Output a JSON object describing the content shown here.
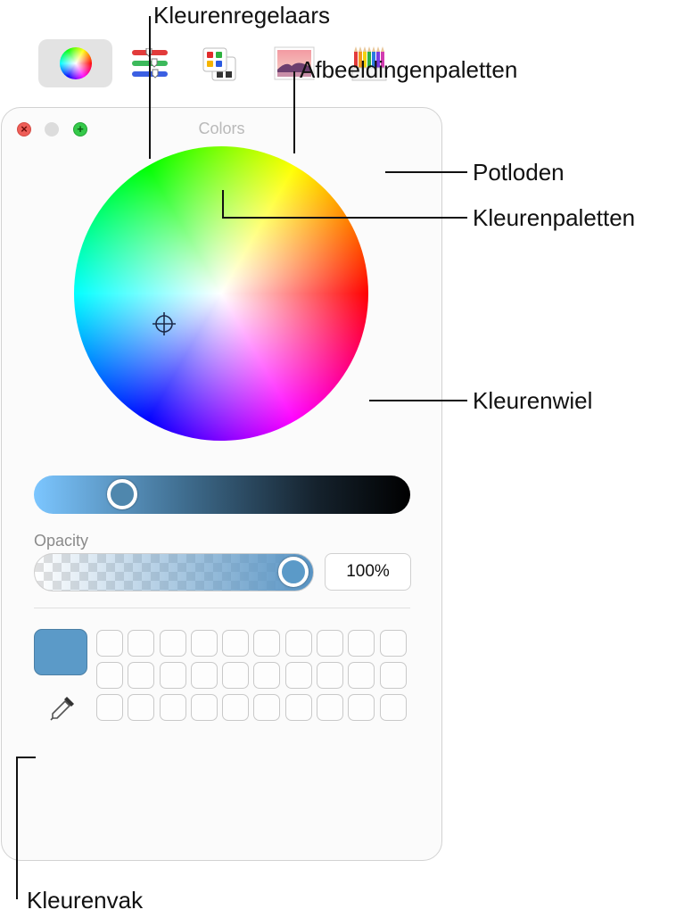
{
  "window": {
    "title": "Colors",
    "traffic": {
      "close": "×",
      "zoom": "+"
    }
  },
  "toolbar": {
    "items": [
      {
        "icon": "color-wheel-icon",
        "active": true
      },
      {
        "icon": "color-sliders-icon",
        "active": false
      },
      {
        "icon": "color-palettes-icon",
        "active": false
      },
      {
        "icon": "image-palettes-icon",
        "active": false
      },
      {
        "icon": "pencils-icon",
        "active": false
      }
    ]
  },
  "brightness": {
    "value": 0.24
  },
  "opacity": {
    "label": "Opacity",
    "value": "100%"
  },
  "selected_color": "#5b9ac8",
  "swatch_grid": {
    "rows": 3,
    "cols": 10
  },
  "callouts": {
    "sliders": "Kleurenregelaars",
    "image_palettes": "Afbeeldingenpaletten",
    "pencils": "Potloden",
    "palettes": "Kleurenpaletten",
    "wheel": "Kleurenwiel",
    "swatch": "Kleurenvak"
  }
}
